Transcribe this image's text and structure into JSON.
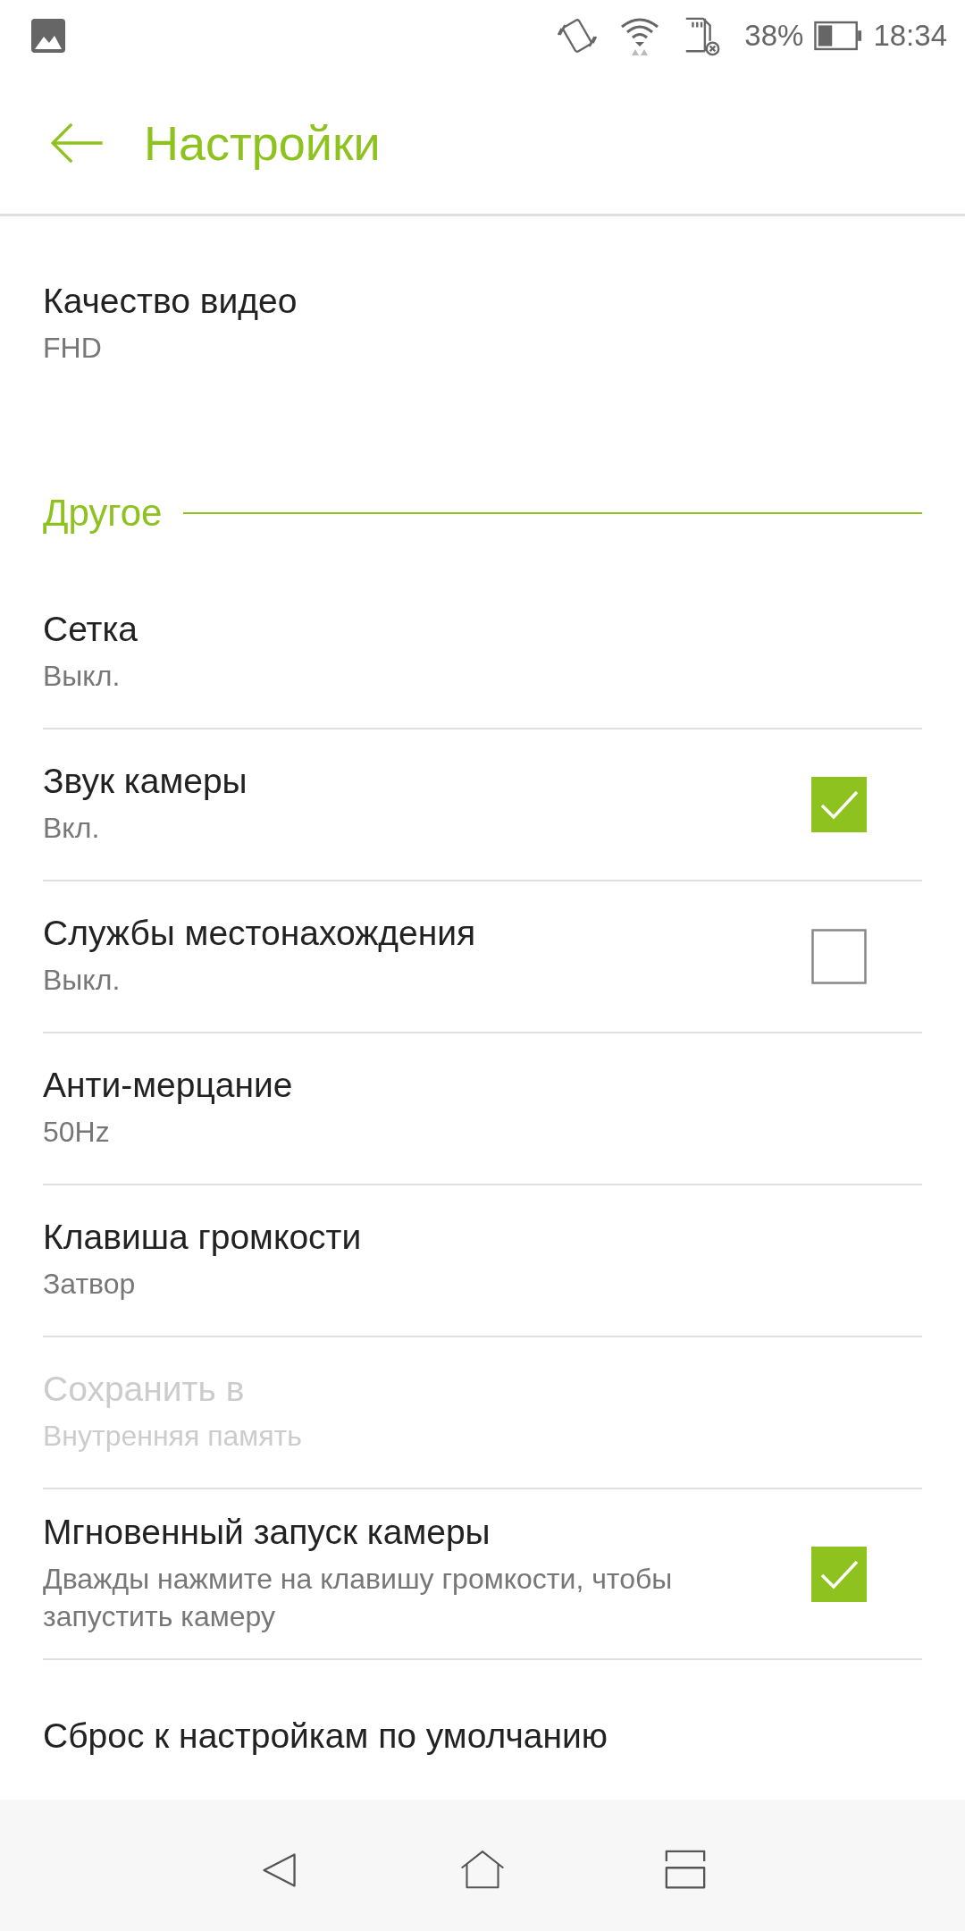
{
  "status_bar": {
    "battery_percent": "38%",
    "time": "18:34"
  },
  "header": {
    "title": "Настройки"
  },
  "items": [
    {
      "kind": "setting",
      "title": "Качество видео",
      "subtitle": "FHD",
      "disabled": false,
      "divider": false
    },
    {
      "kind": "section",
      "title": "Другое"
    },
    {
      "kind": "setting",
      "title": "Сетка",
      "subtitle": "Выкл.",
      "disabled": false,
      "divider": true
    },
    {
      "kind": "checkbox",
      "title": "Звук камеры",
      "subtitle": "Вкл.",
      "checked": true,
      "disabled": false,
      "divider": true
    },
    {
      "kind": "checkbox",
      "title": "Службы местонахождения",
      "subtitle": "Выкл.",
      "checked": false,
      "disabled": false,
      "divider": true
    },
    {
      "kind": "setting",
      "title": "Анти-мерцание",
      "subtitle": "50Hz",
      "disabled": false,
      "divider": true
    },
    {
      "kind": "setting",
      "title": "Клавиша громкости",
      "subtitle": "Затвор",
      "disabled": false,
      "divider": true
    },
    {
      "kind": "setting",
      "title": "Сохранить в",
      "subtitle": "Внутренняя память",
      "disabled": true,
      "divider": true
    },
    {
      "kind": "checkbox",
      "title": "Мгновенный запуск камеры",
      "subtitle": "Дважды нажмите на клавишу громкости, чтобы запустить камеру",
      "checked": true,
      "disabled": false,
      "divider": true
    },
    {
      "kind": "setting",
      "title": "Сброс к настройкам по умолчанию",
      "disabled": false,
      "divider": false
    }
  ]
}
